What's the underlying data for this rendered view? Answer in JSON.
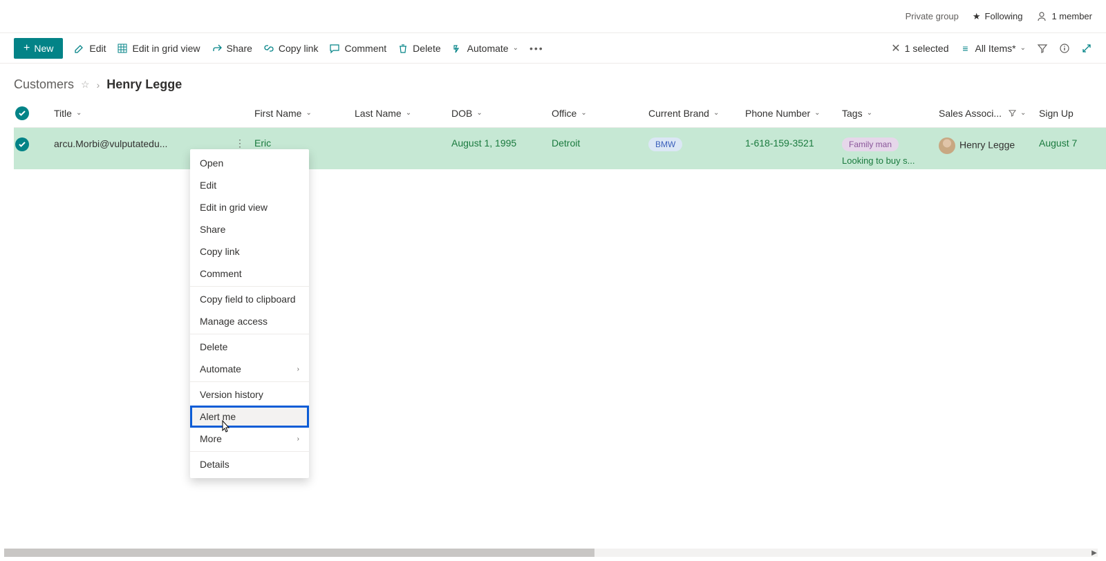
{
  "header": {
    "private_group": "Private group",
    "following": "Following",
    "members": "1 member"
  },
  "toolbar": {
    "new": "New",
    "edit": "Edit",
    "edit_grid": "Edit in grid view",
    "share": "Share",
    "copy_link": "Copy link",
    "comment": "Comment",
    "delete": "Delete",
    "automate": "Automate",
    "selected": "1 selected",
    "view": "All Items*"
  },
  "breadcrumb": {
    "list": "Customers",
    "item": "Henry Legge"
  },
  "columns": {
    "title": "Title",
    "first_name": "First Name",
    "last_name": "Last Name",
    "dob": "DOB",
    "office": "Office",
    "brand": "Current Brand",
    "phone": "Phone Number",
    "tags": "Tags",
    "assoc": "Sales Associ...",
    "signup": "Sign Up"
  },
  "row": {
    "title": "arcu.Morbi@vulputatedu...",
    "first_name": "Eric",
    "last_name": "",
    "dob": "August 1, 1995",
    "office": "Detroit",
    "brand": "BMW",
    "phone": "1-618-159-3521",
    "tag1": "Family man",
    "tag2": "Looking to buy s...",
    "assoc": "Henry Legge",
    "signup": "August 7"
  },
  "context_menu": {
    "open": "Open",
    "edit": "Edit",
    "edit_grid": "Edit in grid view",
    "share": "Share",
    "copy_link": "Copy link",
    "comment": "Comment",
    "copy_field": "Copy field to clipboard",
    "manage_access": "Manage access",
    "delete": "Delete",
    "automate": "Automate",
    "version_history": "Version history",
    "alert_me": "Alert me",
    "more": "More",
    "details": "Details"
  }
}
